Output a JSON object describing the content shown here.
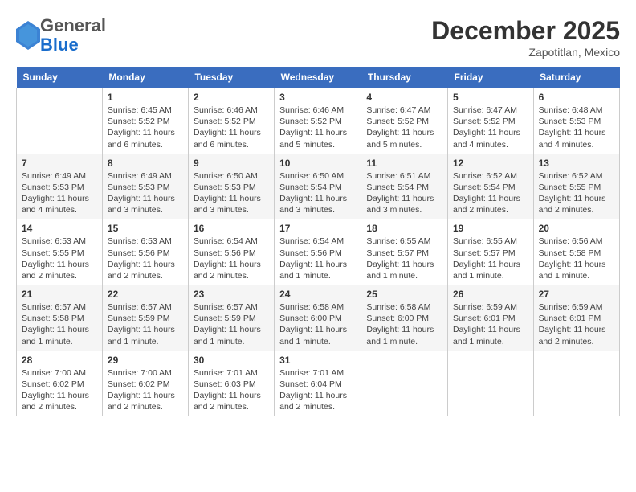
{
  "header": {
    "logo_general": "General",
    "logo_blue": "Blue",
    "month_title": "December 2025",
    "subtitle": "Zapotitlan, Mexico"
  },
  "days_of_week": [
    "Sunday",
    "Monday",
    "Tuesday",
    "Wednesday",
    "Thursday",
    "Friday",
    "Saturday"
  ],
  "weeks": [
    [
      {
        "day": "",
        "info": ""
      },
      {
        "day": "1",
        "info": "Sunrise: 6:45 AM\nSunset: 5:52 PM\nDaylight: 11 hours\nand 6 minutes."
      },
      {
        "day": "2",
        "info": "Sunrise: 6:46 AM\nSunset: 5:52 PM\nDaylight: 11 hours\nand 6 minutes."
      },
      {
        "day": "3",
        "info": "Sunrise: 6:46 AM\nSunset: 5:52 PM\nDaylight: 11 hours\nand 5 minutes."
      },
      {
        "day": "4",
        "info": "Sunrise: 6:47 AM\nSunset: 5:52 PM\nDaylight: 11 hours\nand 5 minutes."
      },
      {
        "day": "5",
        "info": "Sunrise: 6:47 AM\nSunset: 5:52 PM\nDaylight: 11 hours\nand 4 minutes."
      },
      {
        "day": "6",
        "info": "Sunrise: 6:48 AM\nSunset: 5:53 PM\nDaylight: 11 hours\nand 4 minutes."
      }
    ],
    [
      {
        "day": "7",
        "info": "Sunrise: 6:49 AM\nSunset: 5:53 PM\nDaylight: 11 hours\nand 4 minutes."
      },
      {
        "day": "8",
        "info": "Sunrise: 6:49 AM\nSunset: 5:53 PM\nDaylight: 11 hours\nand 3 minutes."
      },
      {
        "day": "9",
        "info": "Sunrise: 6:50 AM\nSunset: 5:53 PM\nDaylight: 11 hours\nand 3 minutes."
      },
      {
        "day": "10",
        "info": "Sunrise: 6:50 AM\nSunset: 5:54 PM\nDaylight: 11 hours\nand 3 minutes."
      },
      {
        "day": "11",
        "info": "Sunrise: 6:51 AM\nSunset: 5:54 PM\nDaylight: 11 hours\nand 3 minutes."
      },
      {
        "day": "12",
        "info": "Sunrise: 6:52 AM\nSunset: 5:54 PM\nDaylight: 11 hours\nand 2 minutes."
      },
      {
        "day": "13",
        "info": "Sunrise: 6:52 AM\nSunset: 5:55 PM\nDaylight: 11 hours\nand 2 minutes."
      }
    ],
    [
      {
        "day": "14",
        "info": "Sunrise: 6:53 AM\nSunset: 5:55 PM\nDaylight: 11 hours\nand 2 minutes."
      },
      {
        "day": "15",
        "info": "Sunrise: 6:53 AM\nSunset: 5:56 PM\nDaylight: 11 hours\nand 2 minutes."
      },
      {
        "day": "16",
        "info": "Sunrise: 6:54 AM\nSunset: 5:56 PM\nDaylight: 11 hours\nand 2 minutes."
      },
      {
        "day": "17",
        "info": "Sunrise: 6:54 AM\nSunset: 5:56 PM\nDaylight: 11 hours\nand 1 minute."
      },
      {
        "day": "18",
        "info": "Sunrise: 6:55 AM\nSunset: 5:57 PM\nDaylight: 11 hours\nand 1 minute."
      },
      {
        "day": "19",
        "info": "Sunrise: 6:55 AM\nSunset: 5:57 PM\nDaylight: 11 hours\nand 1 minute."
      },
      {
        "day": "20",
        "info": "Sunrise: 6:56 AM\nSunset: 5:58 PM\nDaylight: 11 hours\nand 1 minute."
      }
    ],
    [
      {
        "day": "21",
        "info": "Sunrise: 6:57 AM\nSunset: 5:58 PM\nDaylight: 11 hours\nand 1 minute."
      },
      {
        "day": "22",
        "info": "Sunrise: 6:57 AM\nSunset: 5:59 PM\nDaylight: 11 hours\nand 1 minute."
      },
      {
        "day": "23",
        "info": "Sunrise: 6:57 AM\nSunset: 5:59 PM\nDaylight: 11 hours\nand 1 minute."
      },
      {
        "day": "24",
        "info": "Sunrise: 6:58 AM\nSunset: 6:00 PM\nDaylight: 11 hours\nand 1 minute."
      },
      {
        "day": "25",
        "info": "Sunrise: 6:58 AM\nSunset: 6:00 PM\nDaylight: 11 hours\nand 1 minute."
      },
      {
        "day": "26",
        "info": "Sunrise: 6:59 AM\nSunset: 6:01 PM\nDaylight: 11 hours\nand 1 minute."
      },
      {
        "day": "27",
        "info": "Sunrise: 6:59 AM\nSunset: 6:01 PM\nDaylight: 11 hours\nand 2 minutes."
      }
    ],
    [
      {
        "day": "28",
        "info": "Sunrise: 7:00 AM\nSunset: 6:02 PM\nDaylight: 11 hours\nand 2 minutes."
      },
      {
        "day": "29",
        "info": "Sunrise: 7:00 AM\nSunset: 6:02 PM\nDaylight: 11 hours\nand 2 minutes."
      },
      {
        "day": "30",
        "info": "Sunrise: 7:01 AM\nSunset: 6:03 PM\nDaylight: 11 hours\nand 2 minutes."
      },
      {
        "day": "31",
        "info": "Sunrise: 7:01 AM\nSunset: 6:04 PM\nDaylight: 11 hours\nand 2 minutes."
      },
      {
        "day": "",
        "info": ""
      },
      {
        "day": "",
        "info": ""
      },
      {
        "day": "",
        "info": ""
      }
    ]
  ]
}
